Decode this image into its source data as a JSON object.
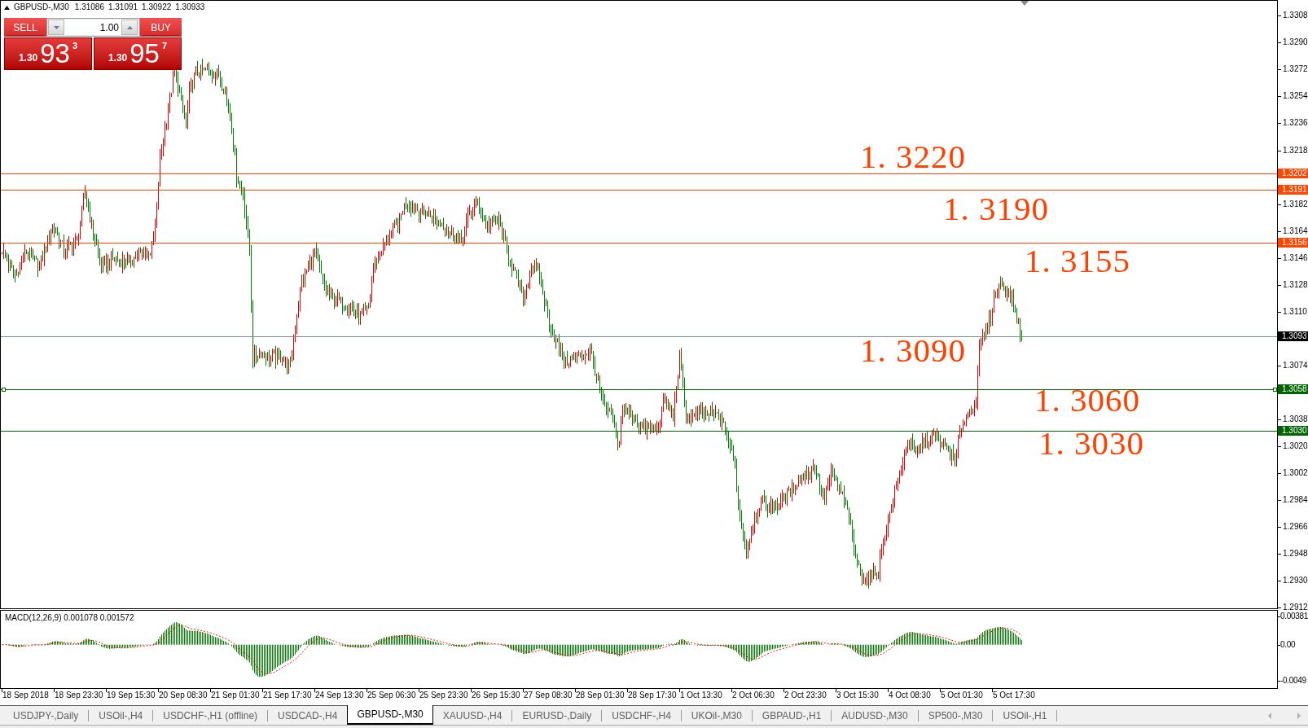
{
  "chart": {
    "header": {
      "symbol": "GBPUSD-,M30",
      "quotes": [
        "1.31086",
        "1.31091",
        "1.30922",
        "1.30933"
      ]
    },
    "one_click": {
      "sell": {
        "label": "SELL",
        "price_head": "1.30",
        "price_big": "93",
        "price_tail": "3"
      },
      "lot": {
        "value": "1.00"
      },
      "buy": {
        "label": "BUY",
        "price_head": "1.30",
        "price_big": "95",
        "price_tail": "7"
      }
    },
    "texts": [
      "1. 3220",
      "1. 3190",
      "1. 3155",
      "1. 3090",
      "1. 3060",
      "1. 3030"
    ],
    "price_lines": [
      {
        "label": "1.3202",
        "color": "#ff4500",
        "selected": false
      },
      {
        "label": "1.3191",
        "color": "#ff4500",
        "selected": false
      },
      {
        "label": "1.3156",
        "color": "#ff4500",
        "selected": false
      },
      {
        "label": "1.3058",
        "color": "#006400",
        "selected": true
      },
      {
        "label": "1.3030",
        "color": "#006400",
        "selected": false
      }
    ],
    "bid_line": {
      "label": "1.3093"
    },
    "price_axis": [
      "1.3308",
      "1.3290",
      "1.3272",
      "1.3254",
      "1.3236",
      "1.3218",
      "1.3182",
      "1.3164",
      "1.3146",
      "1.3128",
      "1.3110",
      "1.3074",
      "1.3038",
      "1.3020",
      "1.3002",
      "1.2984",
      "1.2966",
      "1.2948",
      "1.2930",
      "1.2912"
    ]
  },
  "macd": {
    "title": "MACD(12,26,9) 0.001078 0.001572",
    "axis": [
      "0.00381",
      "0.00",
      "-0.0049"
    ]
  },
  "time_axis": [
    "18 Sep 2018",
    "18 Sep 23:30",
    "19 Sep 15:30",
    "20 Sep 08:30",
    "21 Sep 01:30",
    "21 Sep 17:30",
    "24 Sep 13:30",
    "25 Sep 06:30",
    "25 Sep 23:30",
    "26 Sep 15:30",
    "27 Sep 08:30",
    "28 Sep 01:30",
    "28 Sep 17:30",
    "1 Oct 13:30",
    "2 Oct 06:30",
    "2 Oct 23:30",
    "3 Oct 15:30",
    "4 Oct 08:30",
    "5 Oct 01:30",
    "5 Oct 17:30"
  ],
  "tabs": [
    {
      "label": "USDJPY-,Daily",
      "selected": false
    },
    {
      "label": "USOil-,H4",
      "selected": false
    },
    {
      "label": "USDCHF-,H1 (offline)",
      "selected": false
    },
    {
      "label": "USDCAD-,H4",
      "selected": false
    },
    {
      "label": "GBPUSD-,M30",
      "selected": true
    },
    {
      "label": "XAUUSD-,H4",
      "selected": false
    },
    {
      "label": "EURUSD-,Daily",
      "selected": false
    },
    {
      "label": "USDCHF-,H4",
      "selected": false
    },
    {
      "label": "UKOil-,M30",
      "selected": false
    },
    {
      "label": "GBPAUD-,H1",
      "selected": false
    },
    {
      "label": "AUDUSD-,M30",
      "selected": false
    },
    {
      "label": "SP500-,M30",
      "selected": false
    },
    {
      "label": "USOil-,H1",
      "selected": false
    }
  ]
}
